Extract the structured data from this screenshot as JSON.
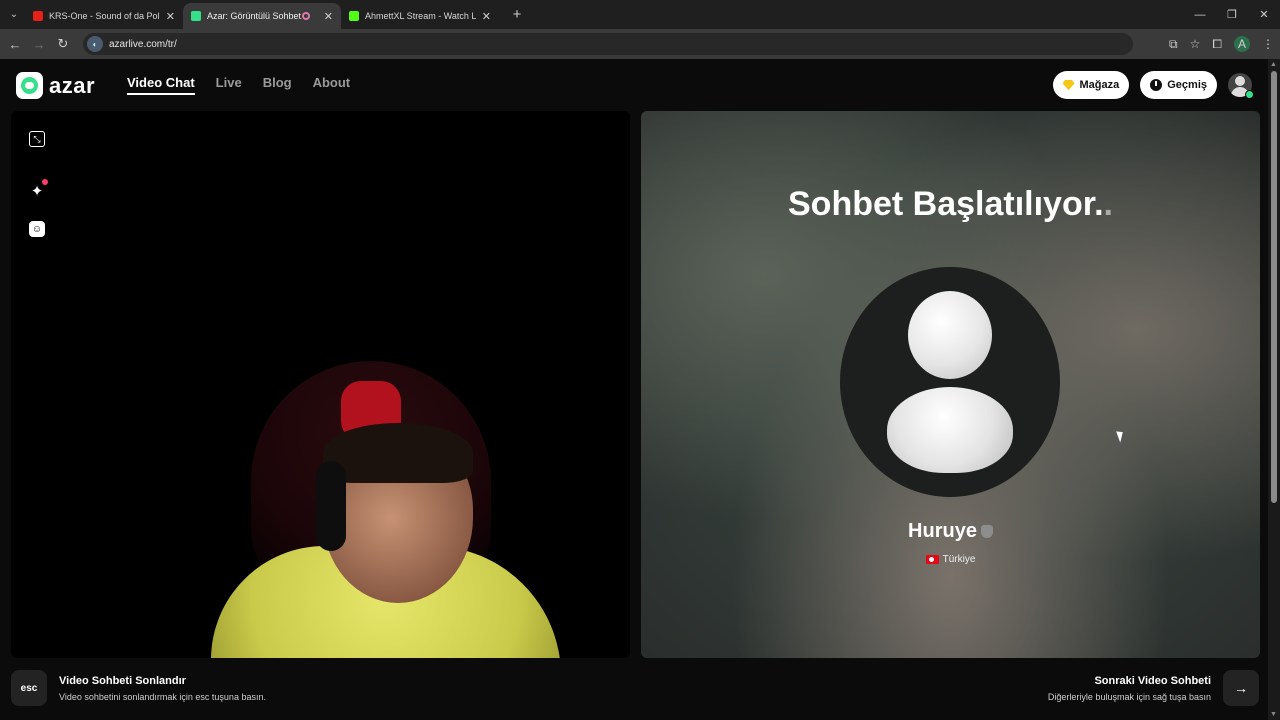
{
  "browser": {
    "tabs": [
      {
        "title": "KRS-One - Sound of da Police (",
        "favicon_color": "#e62117"
      },
      {
        "title": "Azar: Görüntülü Sohbet, Ar",
        "favicon_color": "#35e08a"
      },
      {
        "title": "AhmettXL Stream - Watch Live",
        "favicon_color": "#53fc18"
      }
    ],
    "url": "azarlive.com/tr/",
    "profile_initial": "A"
  },
  "header": {
    "logo_text": "azar",
    "nav": [
      "Video Chat",
      "Live",
      "Blog",
      "About"
    ],
    "store_label": "Mağaza",
    "history_label": "Geçmiş"
  },
  "remote": {
    "status": "Sohbet Başlatılıyor.",
    "status_trailing": ".",
    "username": "Huruye",
    "country": "Türkiye"
  },
  "bottom": {
    "esc_key": "esc",
    "end_title": "Video Sohbeti Sonlandır",
    "end_subtitle": "Video sohbetini sonlandırmak için esc tuşuna basın.",
    "next_title": "Sonraki Video Sohbeti",
    "next_subtitle": "Diğerleriyle buluşmak için sağ tuşa basın"
  },
  "colors": {
    "brand": "#35e08a",
    "accent_gem": "#f5c518"
  }
}
